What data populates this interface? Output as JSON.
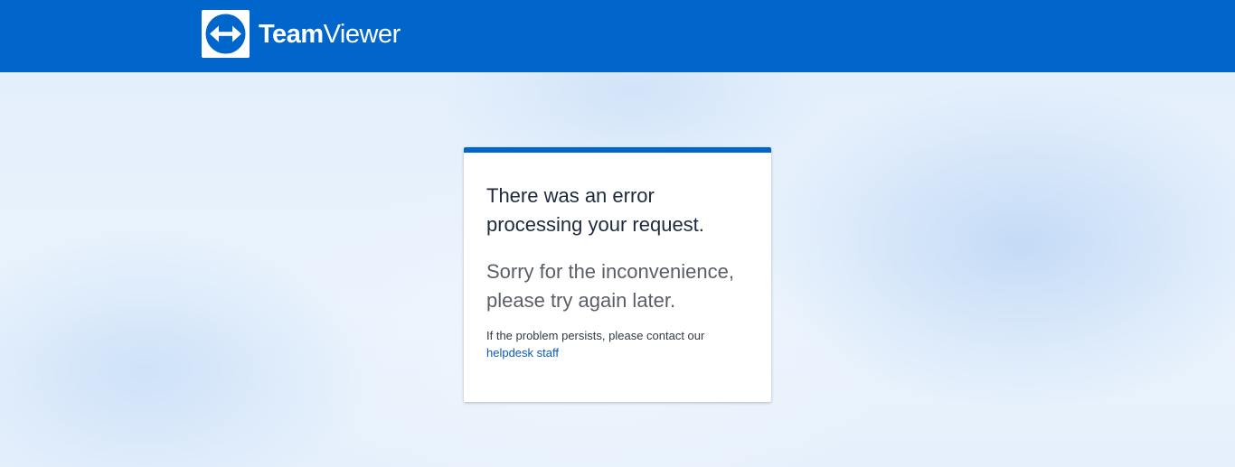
{
  "header": {
    "brand_bold": "Team",
    "brand_light": "Viewer",
    "logo_icon": "double-arrow-circle-icon",
    "background_color": "#0066cc"
  },
  "card": {
    "title": "There was an error processing your request.",
    "subtitle": "Sorry for the inconvenience, please try again later.",
    "note": "If the problem persists, please contact our",
    "link_text": "helpdesk staff",
    "accent_color": "#0066cc"
  }
}
